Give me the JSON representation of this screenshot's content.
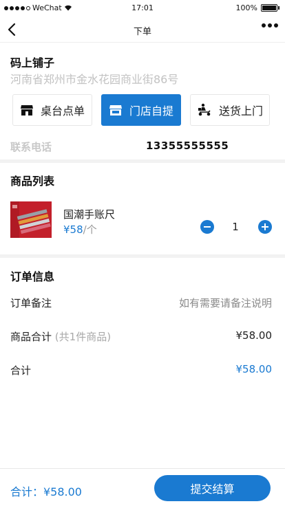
{
  "status_bar": {
    "carrier": "WeChat",
    "time": "17:01",
    "battery": "100%"
  },
  "nav": {
    "title": "下单"
  },
  "shop": {
    "name": "码上铺子",
    "address": "河南省郑州市金水花园商业街86号"
  },
  "modes": [
    {
      "label": "桌台点单",
      "icon": "store-icon",
      "active": false
    },
    {
      "label": "门店自提",
      "icon": "store-pickup-icon",
      "active": true
    },
    {
      "label": "送货上门",
      "icon": "delivery-scooter-icon",
      "active": false
    }
  ],
  "contact": {
    "label": "联系电话",
    "value": "13355555555"
  },
  "goods": {
    "title": "商品列表",
    "items": [
      {
        "name": "国潮手账尺",
        "price": "¥58",
        "unit": "/个",
        "quantity": "1"
      }
    ]
  },
  "order_info": {
    "title": "订单信息",
    "remark_label": "订单备注",
    "remark_placeholder": "如有需要请备注说明",
    "subtotal_label": "商品合计",
    "subtotal_note": "(共1件商品)",
    "subtotal_value": "¥58.00",
    "total_label": "合计",
    "total_value": "¥58.00"
  },
  "bottom": {
    "total_text": "合计：¥58.00",
    "submit_label": "提交结算"
  },
  "colors": {
    "accent": "#1a7ad1",
    "muted_text": "#c2c2c2",
    "divider": "#f2f2f2"
  }
}
